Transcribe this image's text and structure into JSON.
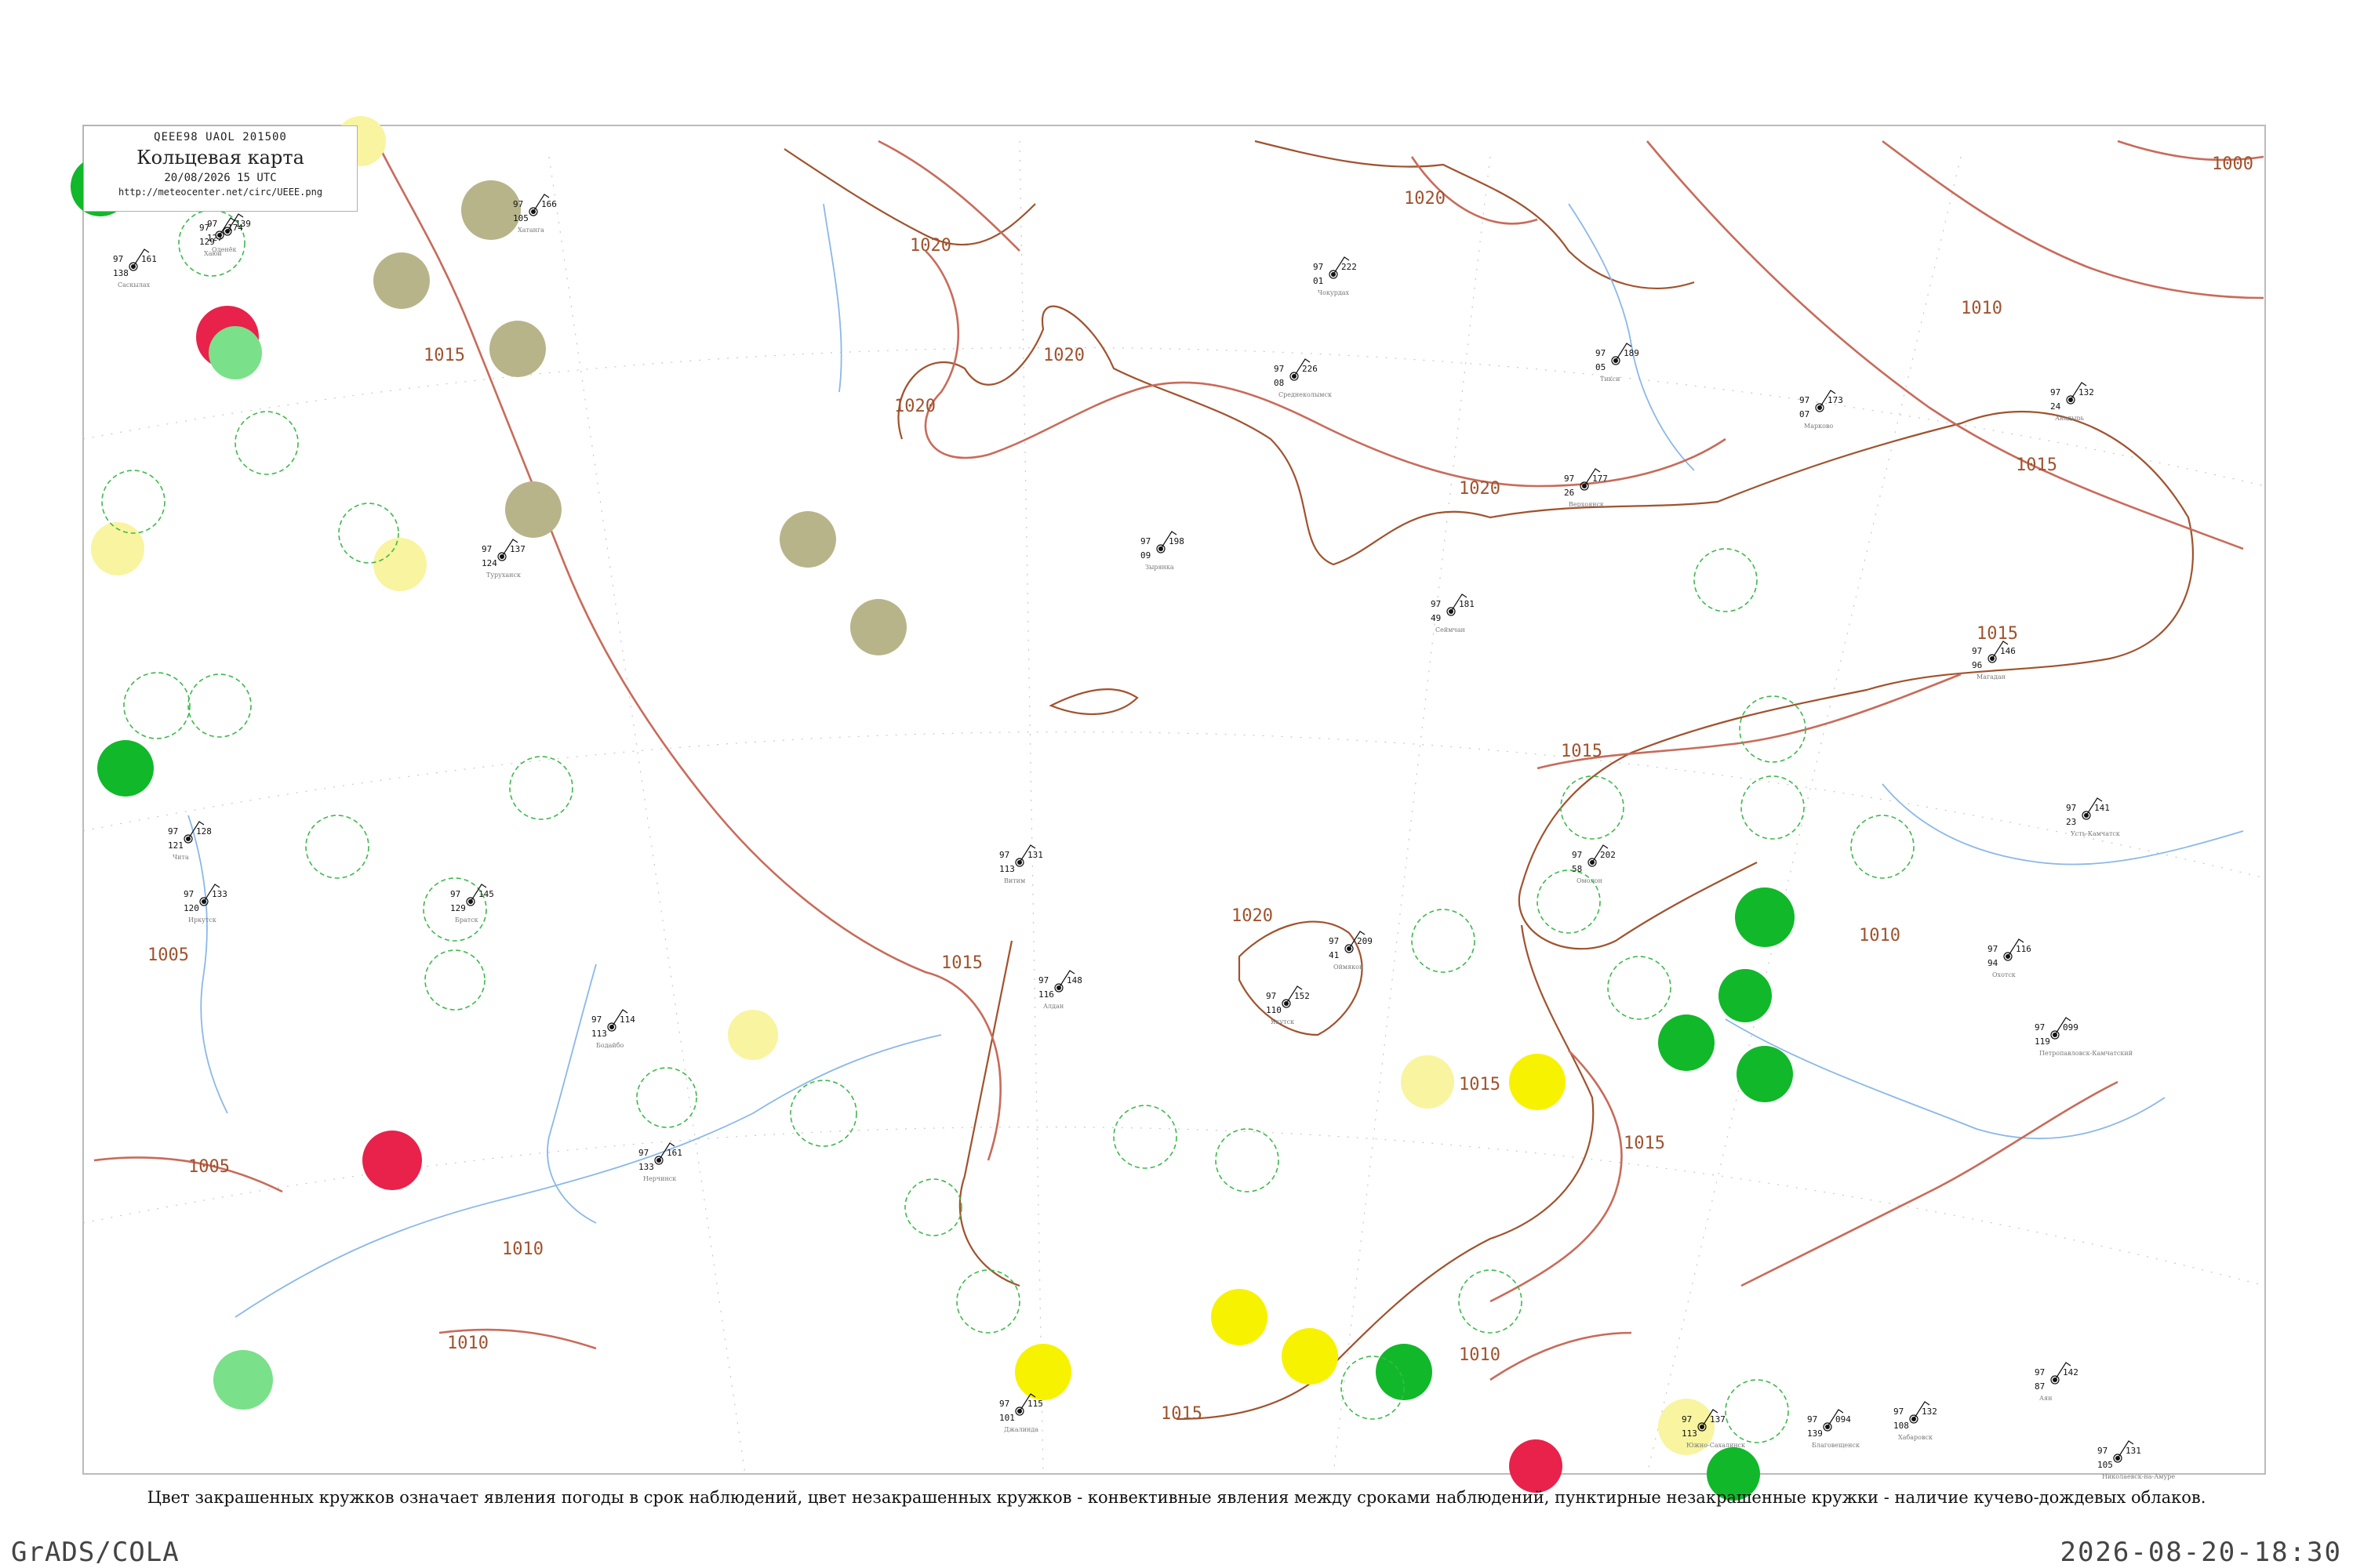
{
  "header": {
    "code_line": "QEEE98  UAOL  201500",
    "title": "Кольцевая карта",
    "date_line": "20/08/2026 15 UTC",
    "url": "http://meteocenter.net/circ/UEEE.png"
  },
  "caption": "Цвет закрашенных кружков означает явления погоды в срок наблюдений, цвет незакрашенных кружков - конвективные явления между сроками наблюдений, пунктирные незакрашенные кружки - наличие кучево-дождевых облаков.",
  "footer": {
    "left": "GrADS/COLA",
    "right": "2026-08-20-18:30"
  },
  "colors": {
    "coast": "#a0522d",
    "isobar": "#c86b5a",
    "river": "#8ab8e8",
    "cb_dashed": "#3cba4a",
    "fill_green": "#11b82a",
    "fill_lightgreen": "#7ae08a",
    "fill_yellow": "#f7f200",
    "fill_lightyellow": "#f8f4a0",
    "fill_red": "#e8224a",
    "fill_olive": "#b8b48a"
  },
  "isobar_labels": [
    "1000",
    "1005",
    "1010",
    "1015",
    "1020"
  ],
  "stations": [
    {
      "name": "Хаюй",
      "p": "174",
      "t": "97",
      "td": "129"
    },
    {
      "name": "Саскылах",
      "p": "161",
      "t": "97",
      "td": "138"
    },
    {
      "name": "Оленёк",
      "p": "139",
      "t": "97",
      "td": "127"
    },
    {
      "name": "Джалинда",
      "p": "115",
      "t": "97",
      "td": "101"
    },
    {
      "name": "Чокурдах",
      "p": "222",
      "t": "97",
      "td": "01"
    },
    {
      "name": "Среднеколымск",
      "p": "226",
      "t": "97",
      "td": "08"
    },
    {
      "name": "Зырянка",
      "p": "198",
      "t": "97",
      "td": "09"
    },
    {
      "name": "Сеймчан",
      "p": "181",
      "t": "97",
      "td": "49"
    },
    {
      "name": "Магадан",
      "p": "146",
      "t": "97",
      "td": "96"
    },
    {
      "name": "Охотск",
      "p": "116",
      "t": "97",
      "td": "94"
    },
    {
      "name": "Аян",
      "p": "142",
      "t": "97",
      "td": "87"
    },
    {
      "name": "Николаевск-на-Амуре",
      "p": "131",
      "t": "97",
      "td": "105"
    },
    {
      "name": "Якутск",
      "p": "152",
      "t": "97",
      "td": "110"
    },
    {
      "name": "Алдан",
      "p": "148",
      "t": "97",
      "td": "116"
    },
    {
      "name": "Витим",
      "p": "131",
      "t": "97",
      "td": "113"
    },
    {
      "name": "Туруханск",
      "p": "137",
      "t": "97",
      "td": "124"
    },
    {
      "name": "Хатанга",
      "p": "166",
      "t": "97",
      "td": "105"
    },
    {
      "name": "Тикси",
      "p": "189",
      "t": "97",
      "td": "05"
    },
    {
      "name": "Верхоянск",
      "p": "177",
      "t": "97",
      "td": "26"
    },
    {
      "name": "Оймякон",
      "p": "209",
      "t": "97",
      "td": "41"
    },
    {
      "name": "Омолон",
      "p": "202",
      "t": "97",
      "td": "58"
    },
    {
      "name": "Анадырь",
      "p": "132",
      "t": "97",
      "td": "24"
    },
    {
      "name": "Марково",
      "p": "173",
      "t": "97",
      "td": "07"
    },
    {
      "name": "Петропавловск-Камчатский",
      "p": "099",
      "t": "97",
      "td": "119"
    },
    {
      "name": "Усть-Камчатск",
      "p": "141",
      "t": "97",
      "td": "23"
    },
    {
      "name": "Южно-Сахалинск",
      "p": "137",
      "t": "97",
      "td": "113"
    },
    {
      "name": "Хабаровск",
      "p": "132",
      "t": "97",
      "td": "108"
    },
    {
      "name": "Благовещенск",
      "p": "094",
      "t": "97",
      "td": "139"
    },
    {
      "name": "Чита",
      "p": "128",
      "t": "97",
      "td": "121"
    },
    {
      "name": "Иркутск",
      "p": "133",
      "t": "97",
      "td": "120"
    },
    {
      "name": "Братск",
      "p": "145",
      "t": "97",
      "td": "129"
    },
    {
      "name": "Нерчинск",
      "p": "161",
      "t": "97",
      "td": "133"
    },
    {
      "name": "Бодайбо",
      "p": "114",
      "t": "97",
      "td": "113"
    }
  ]
}
